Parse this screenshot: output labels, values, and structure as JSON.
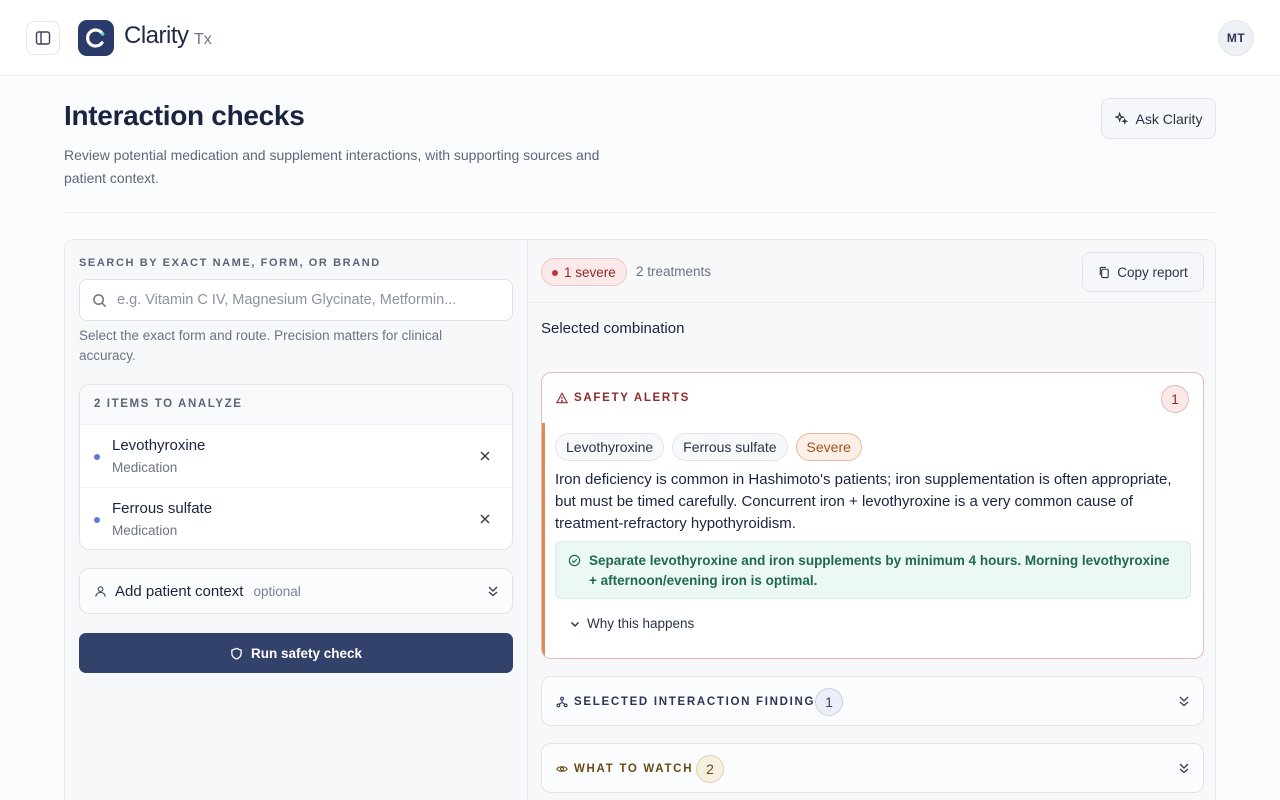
{
  "app": {
    "name": "Clarity",
    "suffix": "Tx",
    "user_initials": "MT"
  },
  "page": {
    "title": "Interaction checks",
    "description": "Review potential medication and supplement interactions, with supporting sources and patient context.",
    "ask_label": "Ask Clarity"
  },
  "search": {
    "label": "SEARCH BY EXACT NAME, FORM, OR BRAND",
    "placeholder": "e.g. Vitamin C IV, Magnesium Glycinate, Metformin...",
    "value": "",
    "hint": "Select the exact form and route. Precision matters for clinical accuracy."
  },
  "items": {
    "header": "2 ITEMS TO ANALYZE",
    "list": [
      {
        "name": "Levothyroxine",
        "type": "Medication"
      },
      {
        "name": "Ferrous sulfate",
        "type": "Medication"
      }
    ]
  },
  "context": {
    "label": "Add patient context",
    "optional": "optional"
  },
  "run_label": "Run safety check",
  "results": {
    "severe_badge": "1 severe",
    "treatments": "2 treatments",
    "copy_label": "Copy report",
    "selected_label": "Selected combination",
    "alerts": {
      "title": "SAFETY ALERTS",
      "count": "1",
      "chips": [
        "Levothyroxine",
        "Ferrous sulfate",
        "Severe"
      ],
      "text": "Iron deficiency is common in Hashimoto's patients; iron supplementation is often appropriate, but must be timed carefully. Concurrent iron + levothyroxine is a very common cause of treatment-refractory hypothyroidism.",
      "advice": "Separate levothyroxine and iron supplements by minimum 4 hours. Morning levothyroxine + afternoon/evening iron is optimal.",
      "why_label": "Why this happens"
    },
    "findings": {
      "title": "SELECTED INTERACTION FINDINGS",
      "count": "1"
    },
    "watch": {
      "title": "WHAT TO WATCH",
      "count": "2"
    }
  },
  "colors": {
    "primary": "#33426b",
    "severe": "#8f2a2a",
    "advice": "#1f6a4f",
    "alert_bar": "#e08a55"
  }
}
